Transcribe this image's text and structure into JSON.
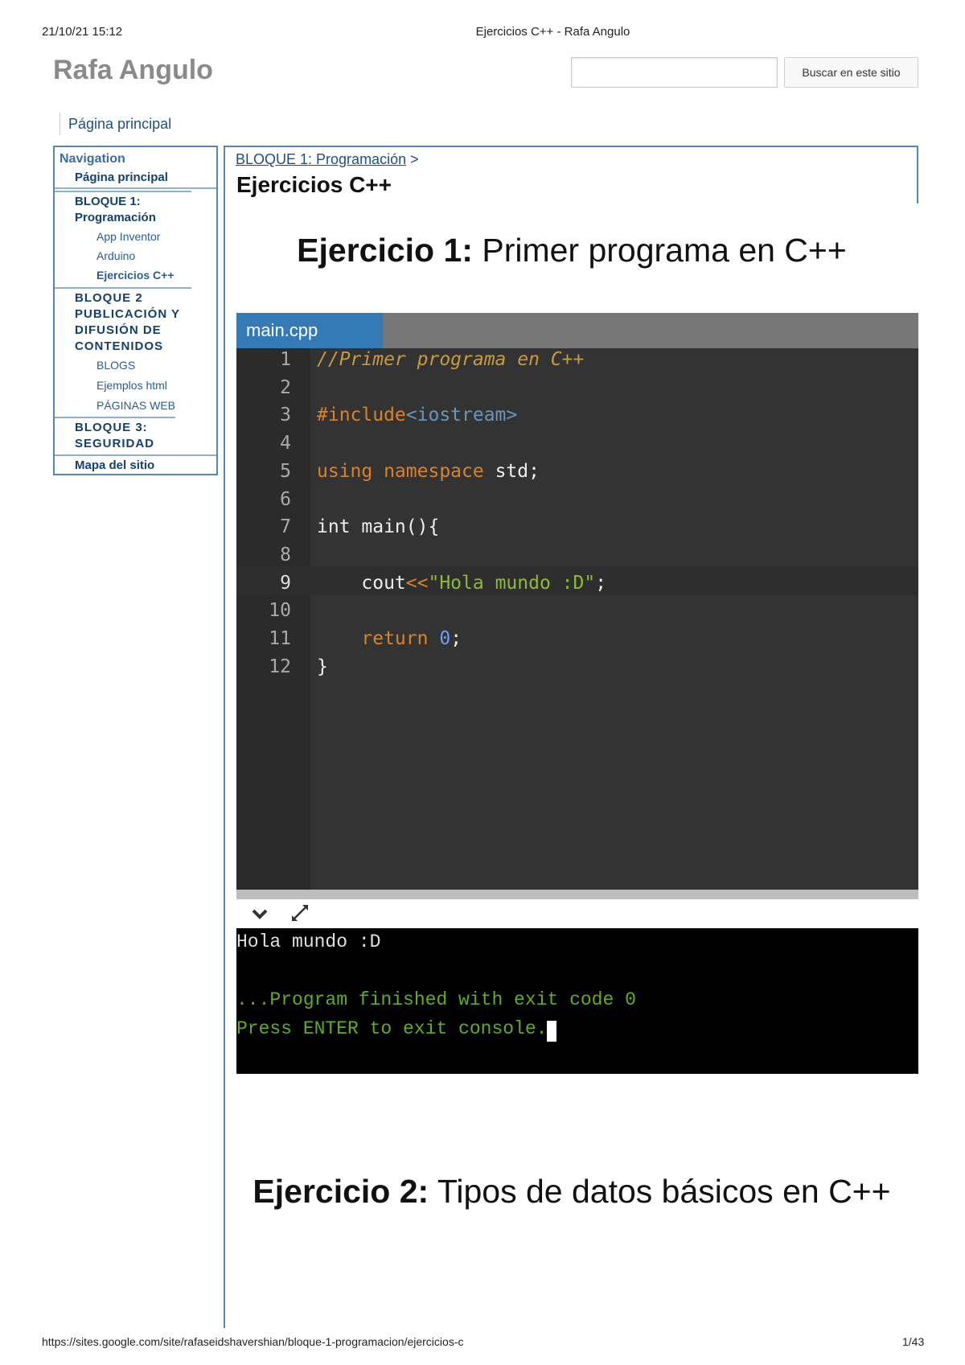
{
  "header": {
    "date": "21/10/21 15:12",
    "title": "Ejercicios C++ - Rafa Angulo"
  },
  "site": {
    "title": "Rafa Angulo",
    "search_placeholder": "",
    "search_button": "Buscar en este sitio",
    "top_tab": "Página principal"
  },
  "sidebar": {
    "title": "Navigation",
    "items": [
      {
        "label": "Página principal"
      },
      {
        "label": "BLOQUE 1: Programación",
        "children": [
          "App Inventor",
          "Arduino",
          "Ejercicios C++"
        ]
      },
      {
        "label": "BLOQUE 2 PUBLICACIÓN Y DIFUSIÓN DE CONTENIDOS",
        "children": [
          "BLOGS",
          "Ejemplos html",
          "PÁGINAS WEB"
        ]
      },
      {
        "label": "BLOQUE 3: SEGURIDAD"
      },
      {
        "label": "Mapa del sitio"
      }
    ]
  },
  "main": {
    "breadcrumb": {
      "link": "BLOQUE 1: Programación",
      "sep": ">"
    },
    "title": "Ejercicios C++",
    "ex1": {
      "bold": "Ejercicio 1:",
      "rest": " Primer programa en C++"
    },
    "ex2": {
      "bold": "Ejercicio 2:",
      "rest": " Tipos de datos básicos en C++"
    }
  },
  "editor": {
    "tab": "main.cpp",
    "colors": {
      "comment": "#c89a3e",
      "keyword": "#d9822b",
      "string": "#8fb83f",
      "number": "#6c9ef8",
      "plain": "#eeeeee",
      "header": "#6897bb"
    },
    "lines": [
      [
        {
          "t": "//Primer programa en C++",
          "c": "comment",
          "i": true
        }
      ],
      [],
      [
        {
          "t": "#include",
          "c": "keyword"
        },
        {
          "t": "<iostream>",
          "c": "header"
        }
      ],
      [],
      [
        {
          "t": "using namespace",
          "c": "keyword"
        },
        {
          "t": " std;",
          "c": "plain"
        }
      ],
      [],
      [
        {
          "t": "int main(){",
          "c": "plain"
        }
      ],
      [],
      [
        {
          "t": "    cout",
          "c": "plain"
        },
        {
          "t": "<<",
          "c": "keyword"
        },
        {
          "t": "\"Hola mundo :D\"",
          "c": "string"
        },
        {
          "t": ";",
          "c": "plain"
        }
      ],
      [],
      [
        {
          "t": "    return ",
          "c": "keyword"
        },
        {
          "t": "0",
          "c": "number"
        },
        {
          "t": ";",
          "c": "plain"
        }
      ],
      [
        {
          "t": "}",
          "c": "plain"
        }
      ]
    ]
  },
  "console": {
    "lines": [
      {
        "t": "Hola mundo :D",
        "c": "#e0e0e0"
      },
      {
        "t": "",
        "c": "#e0e0e0"
      },
      {
        "t": "...Program finished with exit code 0",
        "c": "#5fae1e"
      },
      {
        "t": "Press ENTER to exit console.",
        "c": "#5fae1e"
      }
    ]
  },
  "footer": {
    "url": "https://sites.google.com/site/rafaseidshavershian/bloque-1-programacion/ejercicios-c",
    "page": "1/43"
  }
}
